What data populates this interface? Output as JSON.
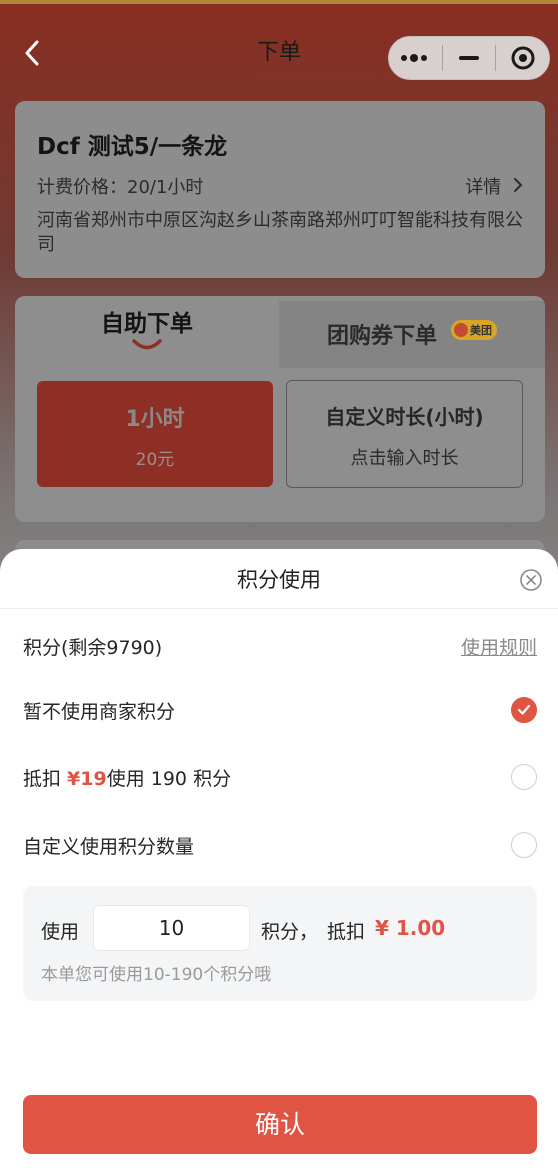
{
  "nav": {
    "title": "下单"
  },
  "store": {
    "name": "Dcf 测试5/一条龙",
    "price": "计费价格：20/1小时",
    "details_label": "详情",
    "address": "河南省郑州市中原区沟赵乡山茶南路郑州叮叮智能科技有限公司"
  },
  "order_tabs": {
    "self_label": "自助下单",
    "voucher_label": "团购券下单",
    "meituan_badge": "美团"
  },
  "options": {
    "hour_title": "1小时",
    "hour_price": "20元",
    "custom_title": "自定义时长(小时)",
    "custom_hint": "点击输入时长"
  },
  "sheet": {
    "title": "积分使用",
    "balance_label": "积分(剩余9790)",
    "rules_label": "使用规则",
    "options": [
      {
        "label": "暂不使用商家积分",
        "selected": true
      },
      {
        "label_prefix": "抵扣 ",
        "amount": "¥19",
        "label_suffix": "使用 190 积分",
        "selected": false
      },
      {
        "label": "自定义使用积分数量",
        "selected": false
      }
    ],
    "custom": {
      "use_label": "使用",
      "value": "10",
      "suffix": "积分，",
      "deduct_label": "抵扣",
      "deduct_amount": "¥ 1.00",
      "hint": "本单您可使用10-190个积分哦"
    },
    "confirm_label": "确认"
  },
  "colors": {
    "accent": "#e05443"
  }
}
